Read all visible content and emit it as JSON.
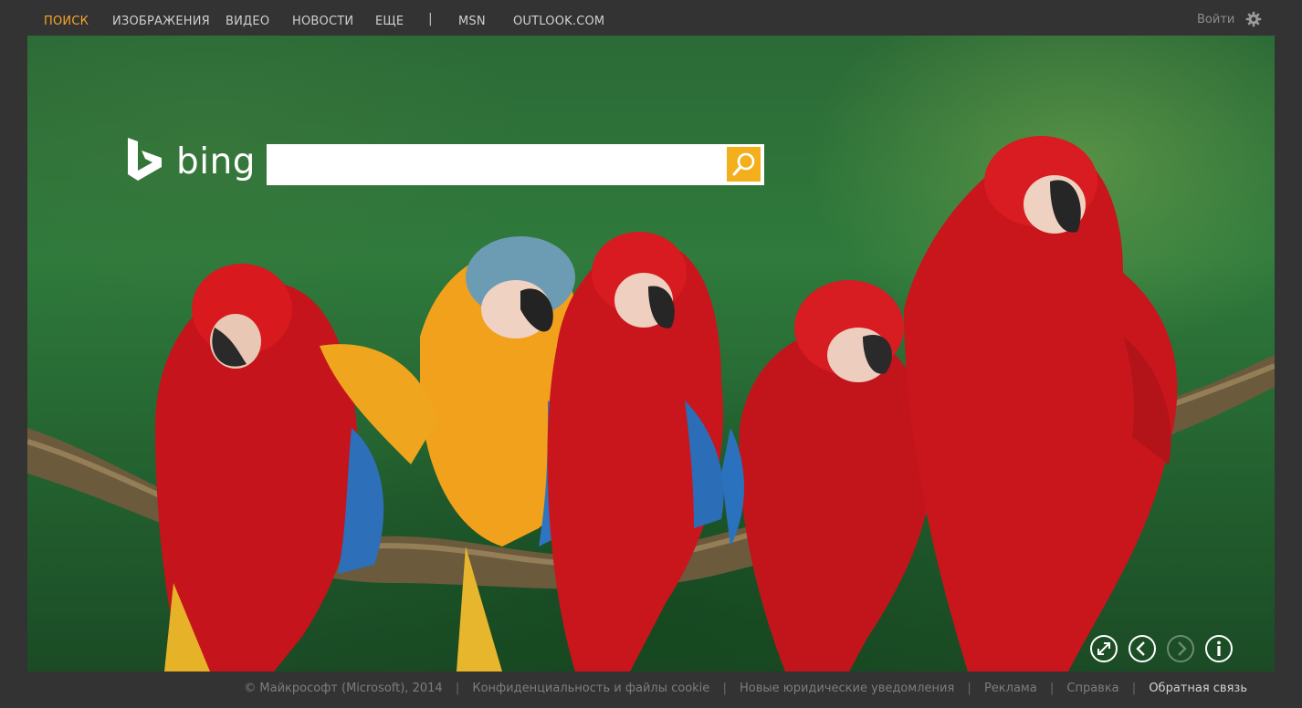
{
  "nav": {
    "items": [
      {
        "label": "ПОИСК",
        "active": true
      },
      {
        "label": "ИЗОБРАЖЕНИЯ"
      },
      {
        "label": "ВИДЕО"
      },
      {
        "label": "НОВОСТИ"
      },
      {
        "label": "ЕЩЕ"
      },
      {
        "label": "MSN"
      },
      {
        "label": "OUTLOOK.COM"
      }
    ],
    "separator": "|",
    "login": "Войти",
    "settings_icon": "gear-icon"
  },
  "brand": {
    "logo_text": "bing"
  },
  "search": {
    "value": "",
    "button_icon": "search-icon",
    "accent": "#f4b01c"
  },
  "hero_controls": [
    "expand-icon",
    "previous-icon",
    "next-icon",
    "info-icon"
  ],
  "footer": {
    "copyright": "© Майкрософт (Microsoft), 2014",
    "links": [
      "Конфиденциальность и файлы cookie",
      "Новые юридические уведомления",
      "Реклама",
      "Справка",
      "Обратная связь"
    ],
    "separator": "|"
  },
  "colors": {
    "nav_active": "#f7a52b",
    "background": "#333333"
  }
}
